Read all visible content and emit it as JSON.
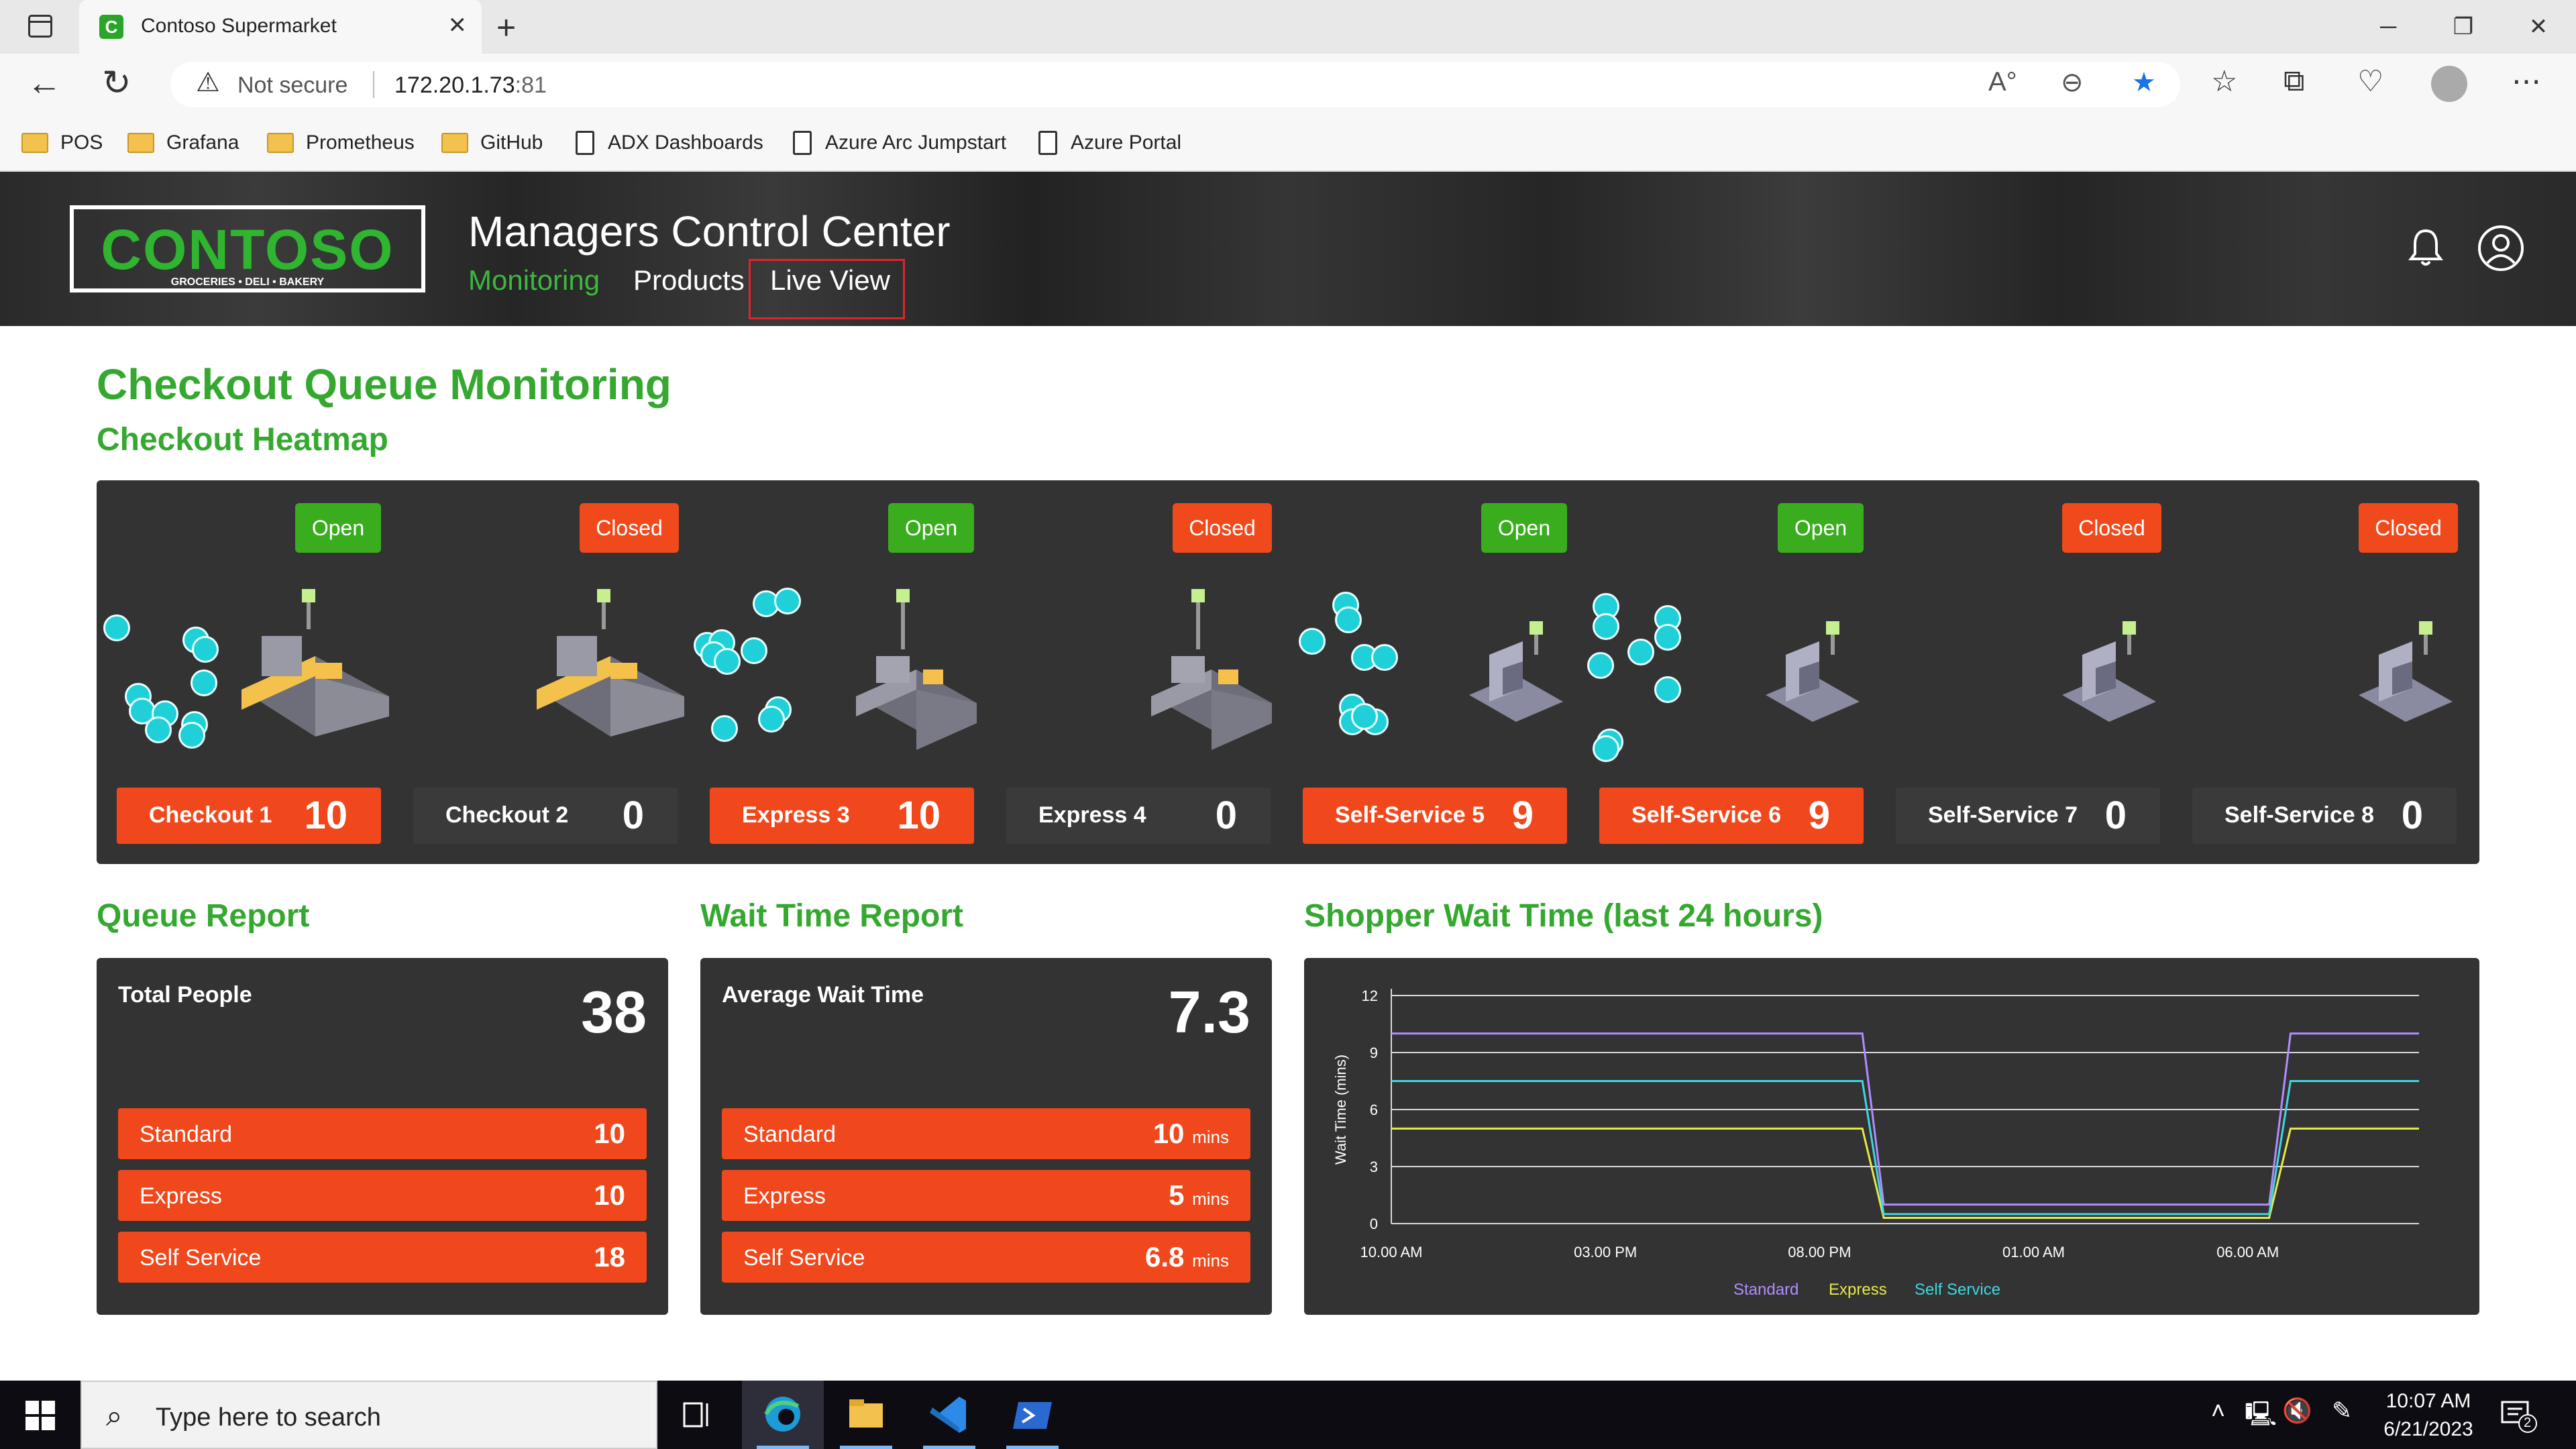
{
  "browser": {
    "tab_title": "Contoso Supermarket",
    "tab_icon": "C",
    "not_secure": "Not secure",
    "url_host": "172.20.1.73",
    "url_port": ":81",
    "bookmarks": [
      {
        "label": "POS",
        "type": "folder"
      },
      {
        "label": "Grafana",
        "type": "folder"
      },
      {
        "label": "Prometheus",
        "type": "folder"
      },
      {
        "label": "GitHub",
        "type": "folder"
      },
      {
        "label": "ADX Dashboards",
        "type": "page"
      },
      {
        "label": "Azure Arc Jumpstart",
        "type": "page"
      },
      {
        "label": "Azure Portal",
        "type": "page"
      }
    ]
  },
  "app": {
    "logo_word": "CONTOSO",
    "logo_tagline": "GROCERIES • DELI • BAKERY",
    "title": "Managers Control Center",
    "nav": [
      "Monitoring",
      "Products",
      "Live View"
    ],
    "brand_color": "#34a82f",
    "alert_color": "#f0481c"
  },
  "page": {
    "title": "Checkout Queue Monitoring",
    "heatmap_title": "Checkout Heatmap",
    "queue_report_title": "Queue Report",
    "wait_report_title": "Wait Time Report",
    "chart_title": "Shopper Wait Time (last 24 hours)"
  },
  "lanes": [
    {
      "name": "Checkout 1",
      "status": "Open",
      "count": "10"
    },
    {
      "name": "Checkout 2",
      "status": "Closed",
      "count": "0"
    },
    {
      "name": "Express 3",
      "status": "Open",
      "count": "10"
    },
    {
      "name": "Express 4",
      "status": "Closed",
      "count": "0"
    },
    {
      "name": "Self-Service 5",
      "status": "Open",
      "count": "9"
    },
    {
      "name": "Self-Service 6",
      "status": "Open",
      "count": "9"
    },
    {
      "name": "Self-Service 7",
      "status": "Closed",
      "count": "0"
    },
    {
      "name": "Self-Service 8",
      "status": "Closed",
      "count": "0"
    }
  ],
  "queue_report": {
    "label": "Total People",
    "total": "38",
    "rows": [
      {
        "label": "Standard",
        "value": "10"
      },
      {
        "label": "Express",
        "value": "10"
      },
      {
        "label": "Self Service",
        "value": "18"
      }
    ]
  },
  "wait_report": {
    "label": "Average Wait Time",
    "total": "7.3",
    "unit": "mins",
    "rows": [
      {
        "label": "Standard",
        "value": "10"
      },
      {
        "label": "Express",
        "value": "5"
      },
      {
        "label": "Self Service",
        "value": "6.8"
      }
    ]
  },
  "chart_data": {
    "type": "line",
    "title": "Shopper Wait Time (last 24 hours)",
    "xlabel": "",
    "ylabel": "Wait Time (mins)",
    "ylim": [
      0,
      12
    ],
    "yticks": [
      0,
      3,
      6,
      9,
      12
    ],
    "xtick_labels": [
      "10.00 AM",
      "03.00 PM",
      "08.00 PM",
      "01.00 AM",
      "06.00 AM"
    ],
    "x_hours": [
      0,
      5.5,
      11,
      11.5,
      20.5,
      21,
      24
    ],
    "grid": true,
    "legend": "bottom-center",
    "series": [
      {
        "name": "Standard",
        "color": "#b28cff",
        "values": [
          10,
          10,
          10,
          1,
          1,
          10,
          10
        ]
      },
      {
        "name": "Express",
        "color": "#e8e84a",
        "values": [
          5,
          5,
          5,
          0.3,
          0.3,
          5,
          5
        ]
      },
      {
        "name": "Self Service",
        "color": "#40d6e0",
        "values": [
          7.5,
          7.5,
          7.5,
          0.5,
          0.5,
          7.5,
          7.5
        ]
      }
    ]
  },
  "taskbar": {
    "search_placeholder": "Type here to search",
    "time": "10:07 AM",
    "date": "6/21/2023",
    "notifications": "2"
  }
}
